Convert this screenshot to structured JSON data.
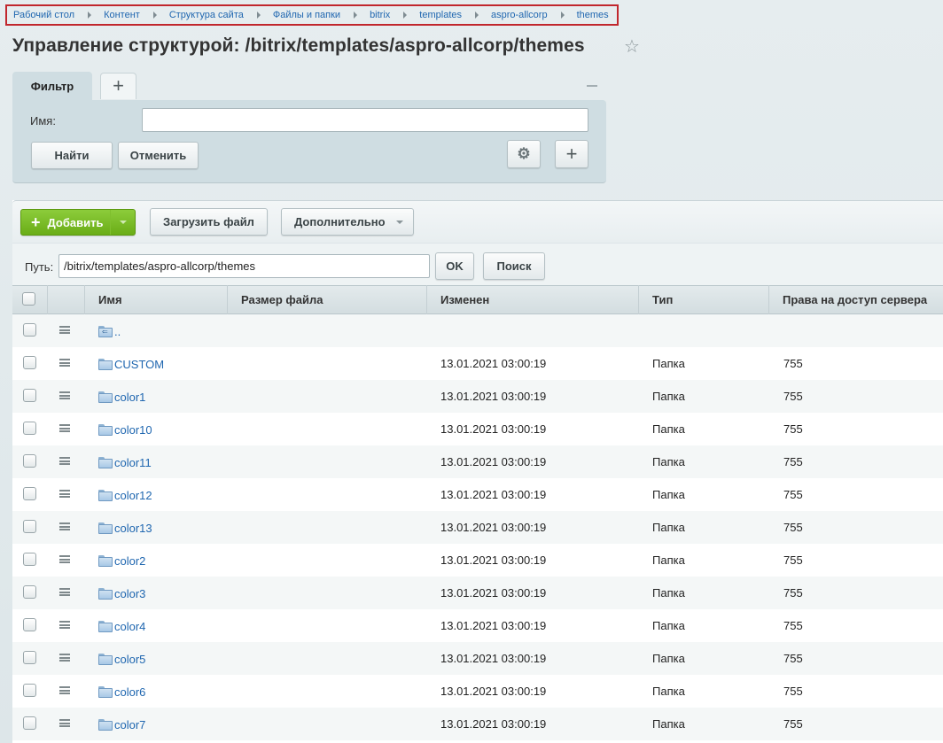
{
  "breadcrumb": [
    "Рабочий стол",
    "Контент",
    "Структура сайта",
    "Файлы и папки",
    "bitrix",
    "templates",
    "aspro-allcorp",
    "themes"
  ],
  "page_title": "Управление структурой: /bitrix/templates/aspro-allcorp/themes",
  "filter": {
    "tab_label": "Фильтр",
    "add_tab": "+",
    "name_label": "Имя:",
    "name_value": "",
    "find_label": "Найти",
    "cancel_label": "Отменить",
    "add_label": "+"
  },
  "toolbar": {
    "add_label": "Добавить",
    "upload_label": "Загрузить файл",
    "more_label": "Дополнительно"
  },
  "path": {
    "label": "Путь:",
    "value": "/bitrix/templates/aspro-allcorp/themes",
    "ok_label": "OK",
    "search_label": "Поиск"
  },
  "table": {
    "columns": [
      "Имя",
      "Размер файла",
      "Изменен",
      "Тип",
      "Права на доступ сервера"
    ],
    "rows": [
      {
        "name": "..",
        "size": "",
        "modified": "",
        "type": "",
        "perms": "",
        "up": true
      },
      {
        "name": "CUSTOM",
        "size": "",
        "modified": "13.01.2021 03:00:19",
        "type": "Папка",
        "perms": "755"
      },
      {
        "name": "color1",
        "size": "",
        "modified": "13.01.2021 03:00:19",
        "type": "Папка",
        "perms": "755"
      },
      {
        "name": "color10",
        "size": "",
        "modified": "13.01.2021 03:00:19",
        "type": "Папка",
        "perms": "755"
      },
      {
        "name": "color11",
        "size": "",
        "modified": "13.01.2021 03:00:19",
        "type": "Папка",
        "perms": "755"
      },
      {
        "name": "color12",
        "size": "",
        "modified": "13.01.2021 03:00:19",
        "type": "Папка",
        "perms": "755"
      },
      {
        "name": "color13",
        "size": "",
        "modified": "13.01.2021 03:00:19",
        "type": "Папка",
        "perms": "755"
      },
      {
        "name": "color2",
        "size": "",
        "modified": "13.01.2021 03:00:19",
        "type": "Папка",
        "perms": "755"
      },
      {
        "name": "color3",
        "size": "",
        "modified": "13.01.2021 03:00:19",
        "type": "Папка",
        "perms": "755"
      },
      {
        "name": "color4",
        "size": "",
        "modified": "13.01.2021 03:00:19",
        "type": "Папка",
        "perms": "755"
      },
      {
        "name": "color5",
        "size": "",
        "modified": "13.01.2021 03:00:19",
        "type": "Папка",
        "perms": "755"
      },
      {
        "name": "color6",
        "size": "",
        "modified": "13.01.2021 03:00:19",
        "type": "Папка",
        "perms": "755"
      },
      {
        "name": "color7",
        "size": "",
        "modified": "13.01.2021 03:00:19",
        "type": "Папка",
        "perms": "755"
      }
    ]
  },
  "colors": {
    "link": "#2067b0",
    "add_button": "#6aad17",
    "highlight_border": "#c1272d"
  },
  "icons": [
    "star-icon",
    "gear-icon",
    "plus-icon",
    "menu-icon",
    "folder-icon",
    "folder-up-icon",
    "chevron-right-icon",
    "chevron-down-icon"
  ]
}
